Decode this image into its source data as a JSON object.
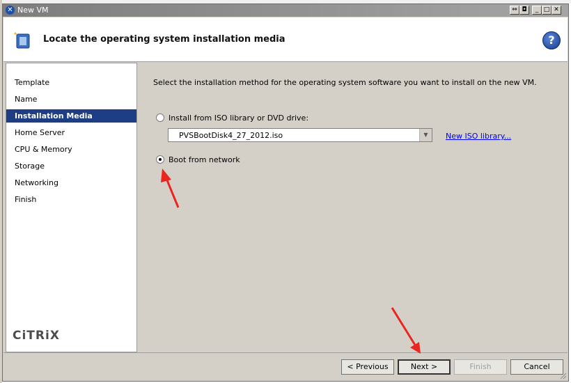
{
  "window": {
    "title": "New VM",
    "controls": [
      "restore-left",
      "restore",
      "minimize",
      "maximize",
      "close"
    ]
  },
  "header": {
    "title": "Locate the operating system installation media",
    "help_label": "?"
  },
  "nav": {
    "items": [
      {
        "label": "Template",
        "active": false
      },
      {
        "label": "Name",
        "active": false
      },
      {
        "label": "Installation Media",
        "active": true
      },
      {
        "label": "Home Server",
        "active": false
      },
      {
        "label": "CPU & Memory",
        "active": false
      },
      {
        "label": "Storage",
        "active": false
      },
      {
        "label": "Networking",
        "active": false
      },
      {
        "label": "Finish",
        "active": false
      }
    ],
    "brand": "CiTRiX"
  },
  "content": {
    "instruction": "Select the installation method for the operating system software you want to install on the new VM.",
    "option_iso": {
      "label": "Install from ISO library or DVD drive:",
      "selected": false
    },
    "iso_select": {
      "value": "PVSBootDisk4_27_2012.iso"
    },
    "new_iso_link": "New ISO library...",
    "option_network": {
      "label": "Boot from network",
      "selected": true
    }
  },
  "footer": {
    "previous": "< Previous",
    "next": "Next >",
    "finish": "Finish",
    "cancel": "Cancel"
  },
  "colors": {
    "active_nav": "#1d3d84",
    "annotation_arrow": "#e8251f",
    "link": "#0000ee"
  }
}
